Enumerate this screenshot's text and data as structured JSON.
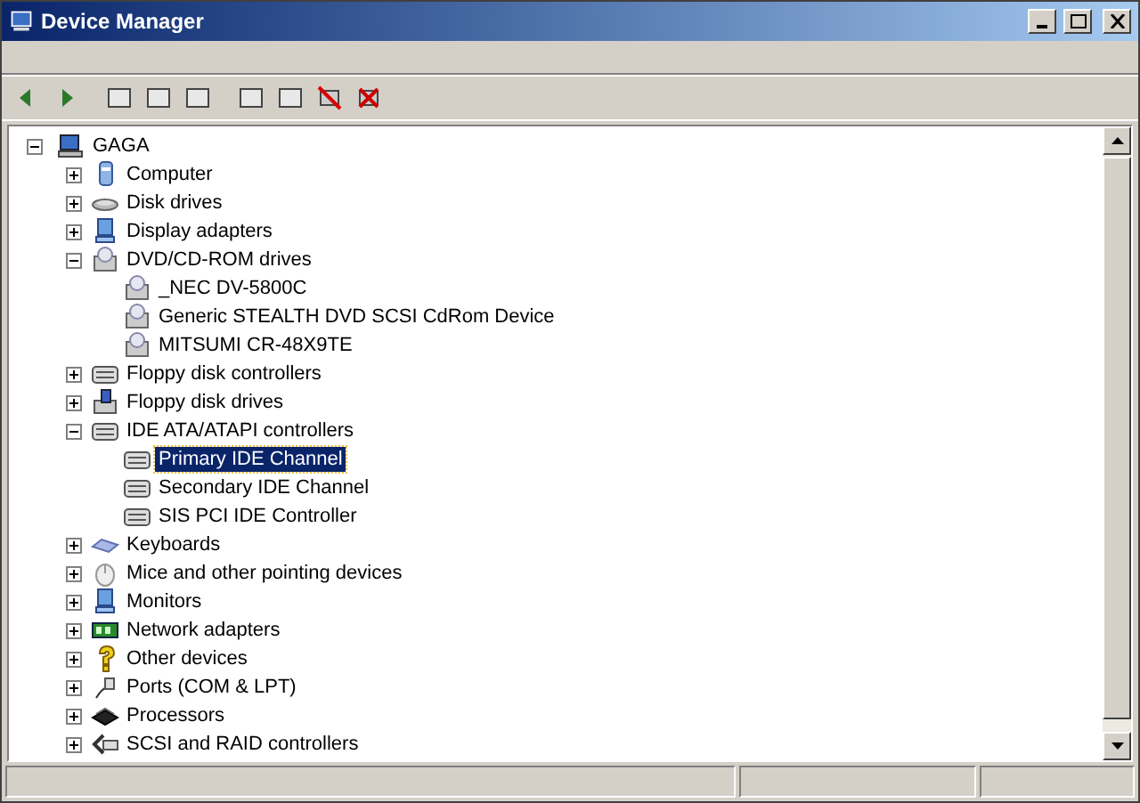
{
  "window": {
    "title": "Device Manager"
  },
  "tree": [
    {
      "label": "GAGA",
      "expanded": true,
      "selected": false,
      "children": [
        {
          "label": "Computer",
          "expanded": false,
          "selected": false
        },
        {
          "label": "Disk drives",
          "expanded": false,
          "selected": false
        },
        {
          "label": "Display adapters",
          "expanded": false,
          "selected": false
        },
        {
          "label": "DVD/CD-ROM drives",
          "expanded": true,
          "selected": false,
          "children": [
            {
              "label": "_NEC DV-5800C",
              "selected": false
            },
            {
              "label": "Generic STEALTH DVD SCSI CdRom Device",
              "selected": false
            },
            {
              "label": "MITSUMI CR-48X9TE",
              "selected": false
            }
          ]
        },
        {
          "label": "Floppy disk controllers",
          "expanded": false,
          "selected": false
        },
        {
          "label": "Floppy disk drives",
          "expanded": false,
          "selected": false
        },
        {
          "label": "IDE ATA/ATAPI controllers",
          "expanded": true,
          "selected": false,
          "children": [
            {
              "label": "Primary IDE Channel",
              "selected": true
            },
            {
              "label": "Secondary IDE Channel",
              "selected": false
            },
            {
              "label": "SIS PCI IDE Controller",
              "selected": false
            }
          ]
        },
        {
          "label": "Keyboards",
          "expanded": false,
          "selected": false
        },
        {
          "label": "Mice and other pointing devices",
          "expanded": false,
          "selected": false
        },
        {
          "label": "Monitors",
          "expanded": false,
          "selected": false
        },
        {
          "label": "Network adapters",
          "expanded": false,
          "selected": false
        },
        {
          "label": "Other devices",
          "expanded": false,
          "selected": false
        },
        {
          "label": "Ports (COM & LPT)",
          "expanded": false,
          "selected": false
        },
        {
          "label": "Processors",
          "expanded": false,
          "selected": false
        },
        {
          "label": "SCSI and RAID controllers",
          "expanded": false,
          "selected": false
        }
      ]
    }
  ]
}
